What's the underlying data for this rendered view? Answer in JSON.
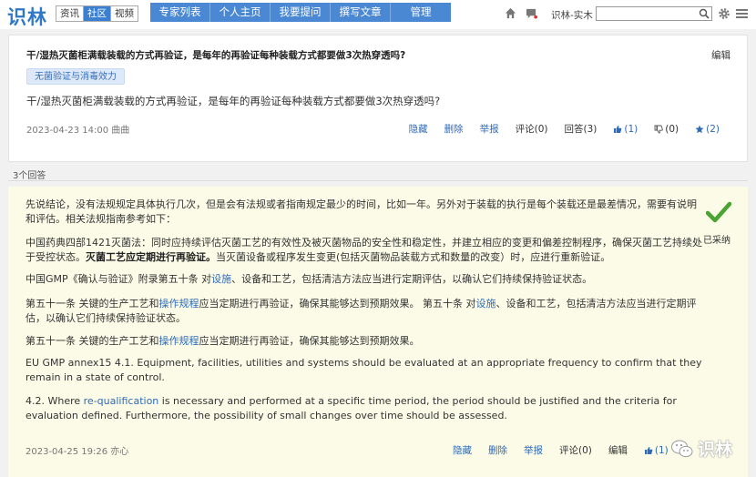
{
  "header": {
    "logo": "识林",
    "segments": [
      {
        "label": "资讯",
        "active": false
      },
      {
        "label": "社区",
        "active": true
      },
      {
        "label": "视频",
        "active": false
      }
    ],
    "nav": [
      "专家列表",
      "个人主页",
      "我要提问",
      "撰写文章",
      "管理"
    ],
    "user_name": "识林-实木",
    "search_placeholder": "",
    "accent": "#4a88d4"
  },
  "question": {
    "title": "干/湿热灭菌柜满载装载的方式再验证，是每年的再验证每种装载方式都要做3次热穿透吗?",
    "edit_label": "编辑",
    "tag": "无菌验证与消毒效力",
    "body": "干/湿热灭菌柜满载装载的方式再验证，是每年的再验证每种装载方式都要做3次热穿透吗?",
    "meta": "2023-04-23 14:00  曲曲",
    "actions": {
      "hide": "隐藏",
      "delete": "删除",
      "report": "举报",
      "comments": "评论(0)",
      "answers": "回答(3)",
      "like": "(1)",
      "dislike": "(0)",
      "star": "(2)"
    }
  },
  "answers_count": "3个回答",
  "answer": {
    "p1": "先说结论，没有法规规定具体执行几次，但是会有法规或者指南规定最少的时间，比如一年。另外对于装载的执行是每个装载还是最差情况，需要有说明和评估。相关法规指南参考如下：",
    "p2_a": "中国药典四部1421灭菌法：同时应持续评估灭菌工艺的有效性及被灭菌物品的安全性和稳定性，并建立相应的变更和偏差控制程序，确保灭菌工艺持续处于受控状态。",
    "p2_b": "灭菌工艺应定期进行再验证。",
    "p2_c": "当灭菌设备或程序发生变更(包括灭菌物品装载方式和数量的改变）时，应进行重新验证。",
    "p3_a": "中国GMP《确认与验证》附录第五十条   对",
    "p3_link": "设施",
    "p3_b": "、设备和工艺，包括清洁方法应当进行定期评估，以确认它们持续保持验证状态。",
    "p4_a": "第五十一条   关键的生产工艺和",
    "p4_link1": "操作规程",
    "p4_b": "应当定期进行再验证，确保其能够达到预期效果。    第五十条   对",
    "p4_link2": "设施",
    "p4_c": "、设备和工艺，包括清洁方法应当进行定期评估，以确认它们持续保持验证状态。",
    "p5_a": "第五十一条   关键的生产工艺和",
    "p5_link": "操作规程",
    "p5_b": "应当定期进行再验证，确保其能够达到预期效果。",
    "p6": "EU GMP annex15 4.1. Equipment, facilities, utilities and systems should be evaluated at an appropriate frequency to confirm that they remain in a state of control.",
    "p7_a": "4.2. Where ",
    "p7_link": "re-qualification",
    "p7_b": " is necessary and performed at a specific time period, the period should be justified and the criteria for evaluation defined. Furthermore, the possibility of small changes over time should be assessed.",
    "adopted": "已采纳",
    "meta": "2023-04-25 19:26  亦心",
    "actions": {
      "hide": "隐藏",
      "delete": "删除",
      "report": "举报",
      "comments": "评论(0)",
      "edit": "编辑",
      "like": "(1)"
    },
    "watermark": "识林"
  }
}
